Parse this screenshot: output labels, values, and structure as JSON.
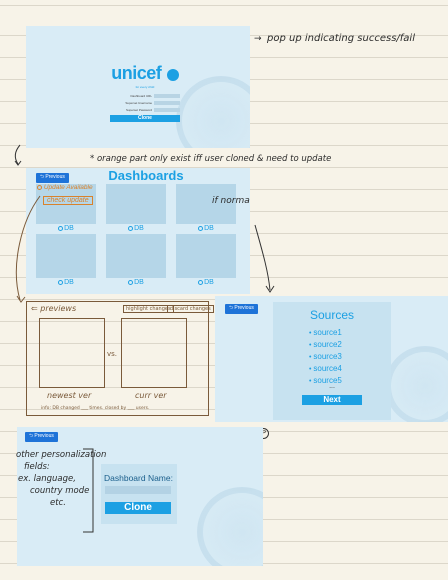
{
  "notes": {
    "popup": "pop up indicating success/fail",
    "orange": "* orange part only exist iff user cloned & need to update",
    "normal_clone": "if normal clone",
    "update_available": "Update Available",
    "check_update": "check update",
    "circled_p": "P",
    "personalization": [
      "other personalization",
      "fields:",
      "ex. language,",
      "country mode",
      "etc."
    ]
  },
  "login": {
    "brand": "unicef",
    "tagline": "for every child",
    "fields": [
      "Dashboard URL",
      "Superset Username",
      "Superset Password"
    ],
    "clone_button": "Clone"
  },
  "dashboards": {
    "previous_button": "Previous",
    "title": "Dashboards",
    "tile_labels": [
      "DB",
      "DB",
      "DB",
      "DB",
      "DB",
      "DB"
    ]
  },
  "previews": {
    "back_label": "previews",
    "highlight_changes": "highlight changes",
    "discard_changes": "discard changes",
    "vs": "vs.",
    "newest": "newest ver",
    "current": "curr ver",
    "footer": "info: DB changed ___ times. closed by ___ users."
  },
  "sources": {
    "previous_button": "Previous",
    "title": "Sources",
    "items": [
      "source1",
      "source2",
      "source3",
      "source4",
      "source5"
    ],
    "ellipsis": "...",
    "next_button": "Next"
  },
  "clone_form": {
    "previous_button": "Previous",
    "label": "Dashboard Name:",
    "clone_button": "Clone"
  }
}
